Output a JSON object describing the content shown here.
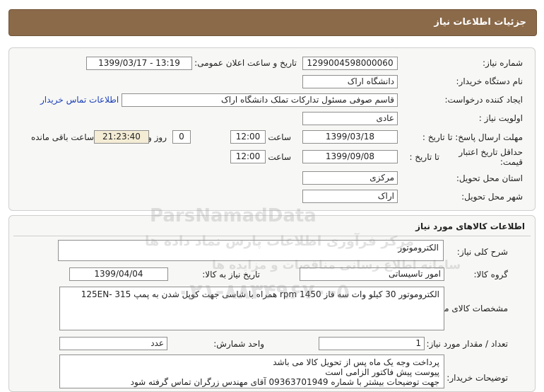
{
  "header": {
    "title": "جزئیات اطلاعات نیاز"
  },
  "info": {
    "need_number_label": "شماره نیاز:",
    "need_number": "1299004598000060",
    "announce_label": "تاریخ و ساعت اعلان عمومی:",
    "announce_value": "1399/03/17 - 13:19",
    "buyer_org_label": "نام دستگاه خریدار:",
    "buyer_org": "دانشگاه اراک",
    "requester_label": "ایجاد کننده درخواست:",
    "requester": "قاسم صوفی مسئول تدارکات تملک دانشگاه اراک",
    "contact_link": "اطلاعات تماس خریدار",
    "priority_label": "اولویت نیاز :",
    "priority": "عادی",
    "send_deadline_label": "مهلت ارسال پاسخ: تا تاریخ :",
    "send_date": "1399/03/18",
    "time_label": "ساعت",
    "send_time": "12:00",
    "days_value": "0",
    "days_label": "روز و",
    "remaining_time": "21:23:40",
    "remaining_label": "ساعت باقی مانده",
    "validity_label": "حداقل تاریخ اعتبار قیمت:",
    "validity_to_label": "تا تاریخ :",
    "validity_date": "1399/09/08",
    "validity_time_label": "ساعت",
    "validity_time": "12:00",
    "province_label": "استان محل تحویل:",
    "province": "مرکزی",
    "city_label": "شهر محل تحویل:",
    "city": "اراک"
  },
  "goods": {
    "section_title": "اطلاعات کالاهای مورد نیاز",
    "desc_label": "شرح کلی نیاز:",
    "desc": "الکتروموتور",
    "group_label": "گروه کالا:",
    "group": "امور تاسیساتی",
    "need_date_label": "تاریخ نیاز به کالا:",
    "need_date": "1399/04/04",
    "spec_label": "مشخصات کالای مورد نیاز:",
    "spec": "الکتروموتور 30 کیلو وات سه فاز rpm 1450   همراه با شاسی جهت کوپل شدن به پمپ 315 -125EN",
    "qty_label": "تعداد / مقدار مورد نیاز:",
    "qty": "1",
    "unit_label": "واحد شمارش:",
    "unit": "عدد",
    "buyer_notes_label": "توضیحات خریدار:",
    "buyer_notes_1": "پرداخت وجه یک ماه پس از تحویل کالا می باشد",
    "buyer_notes_2": "پیوست پیش فاکتور الزامی است",
    "buyer_notes_3": "جهت توضیحات بیشتر با شماره 09363701949 آقای مهندس زرگران تماس گرفته شود"
  },
  "watermark": {
    "brand": "ParsNamadData",
    "line1": "مرکز فرآوری اطلاعات پارس نماد داده ها",
    "line2": "سامانه اطلاع رسانی مناقصات و مزایده ها",
    "phone": "۰۲۱-۸۸۳۴۹۶۷۰-۵"
  }
}
